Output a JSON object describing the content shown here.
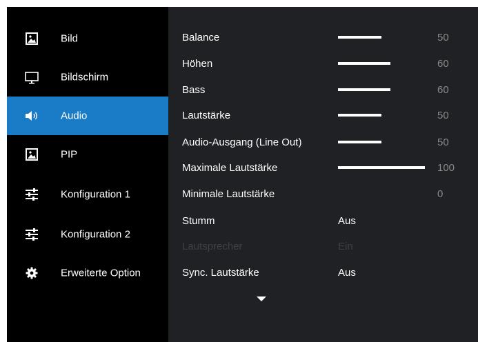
{
  "colors": {
    "active_bg": "#1a7bc6",
    "content_bg": "#202124",
    "value_gray": "#8a8a8a",
    "disabled": "#3f4044"
  },
  "sidebar": {
    "items": [
      {
        "label": "Bild",
        "icon": "picture-icon"
      },
      {
        "label": "Bildschirm",
        "icon": "monitor-icon"
      },
      {
        "label": "Audio",
        "icon": "speaker-icon",
        "active": true
      },
      {
        "label": "PIP",
        "icon": "picture-icon"
      },
      {
        "label": "Konfiguration 1",
        "icon": "sliders-icon"
      },
      {
        "label": "Konfiguration 2",
        "icon": "sliders-icon"
      },
      {
        "label": "Erweiterte Option",
        "icon": "gear-icon"
      }
    ]
  },
  "audio": {
    "settings": [
      {
        "name": "Balance",
        "value": "50",
        "level": 50
      },
      {
        "name": "Höhen",
        "value": "60",
        "level": 60
      },
      {
        "name": "Bass",
        "value": "60",
        "level": 60
      },
      {
        "name": "Lautstärke",
        "value": "50",
        "level": 50
      },
      {
        "name": "Audio-Ausgang (Line Out)",
        "value": "50",
        "level": 50
      },
      {
        "name": "Maximale Lautstärke",
        "value": "100",
        "level": 100
      },
      {
        "name": "Minimale Lautstärke",
        "value": "0",
        "level": 0
      },
      {
        "name": "Stumm",
        "value": "Aus"
      },
      {
        "name": "Lautsprecher",
        "value": "Ein",
        "disabled": true
      },
      {
        "name": "Sync. Lautstärke",
        "value": "Aus"
      }
    ],
    "more_icon": "chevron-down-icon"
  }
}
